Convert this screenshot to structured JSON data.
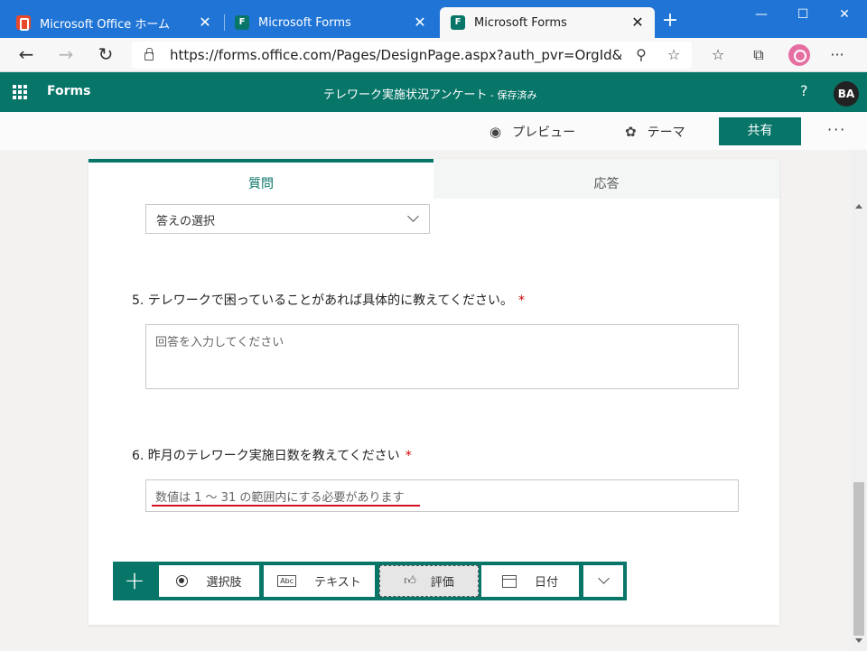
{
  "browser": {
    "tabs": [
      {
        "title": "Microsoft Office ホーム",
        "icon": "office-icon",
        "active": false
      },
      {
        "title": "Microsoft Forms",
        "icon": "forms-icon",
        "active": false
      },
      {
        "title": "Microsoft Forms",
        "icon": "forms-icon",
        "active": true
      }
    ],
    "url": "https://forms.office.com/Pages/DesignPage.aspx?auth_pvr=OrgId&a...",
    "window_controls": {
      "minimize": "—",
      "maximize": "☐",
      "close": "✕"
    }
  },
  "forms": {
    "brand": "Forms",
    "title": "テレワーク実施状況アンケート",
    "status": " - 保存済み",
    "help": "?",
    "user_initials": "BA"
  },
  "commands": {
    "preview": "プレビュー",
    "theme": "テーマ",
    "share": "共有",
    "more": "···"
  },
  "form_tabs": {
    "questions": "質問",
    "responses": "応答"
  },
  "questions": {
    "q4_select_placeholder": "答えの選択",
    "q5": {
      "title": "5. テレワークで困っていることがあれば具体的に教えてください。",
      "required": "*",
      "placeholder": "回答を入力してください"
    },
    "q6": {
      "title": "6. 昨月のテレワーク実施日数を教えてください",
      "required": "*",
      "placeholder": "数値は 1 ～ 31 の範囲内にする必要があります"
    }
  },
  "add_toolbar": {
    "plus": "+",
    "choice": "選択肢",
    "text": "テキスト",
    "rating": "評価",
    "date": "日付"
  },
  "colors": {
    "forms_green": "#077568",
    "browser_blue": "#1f74d6",
    "underline_red": "#d40f1f"
  }
}
